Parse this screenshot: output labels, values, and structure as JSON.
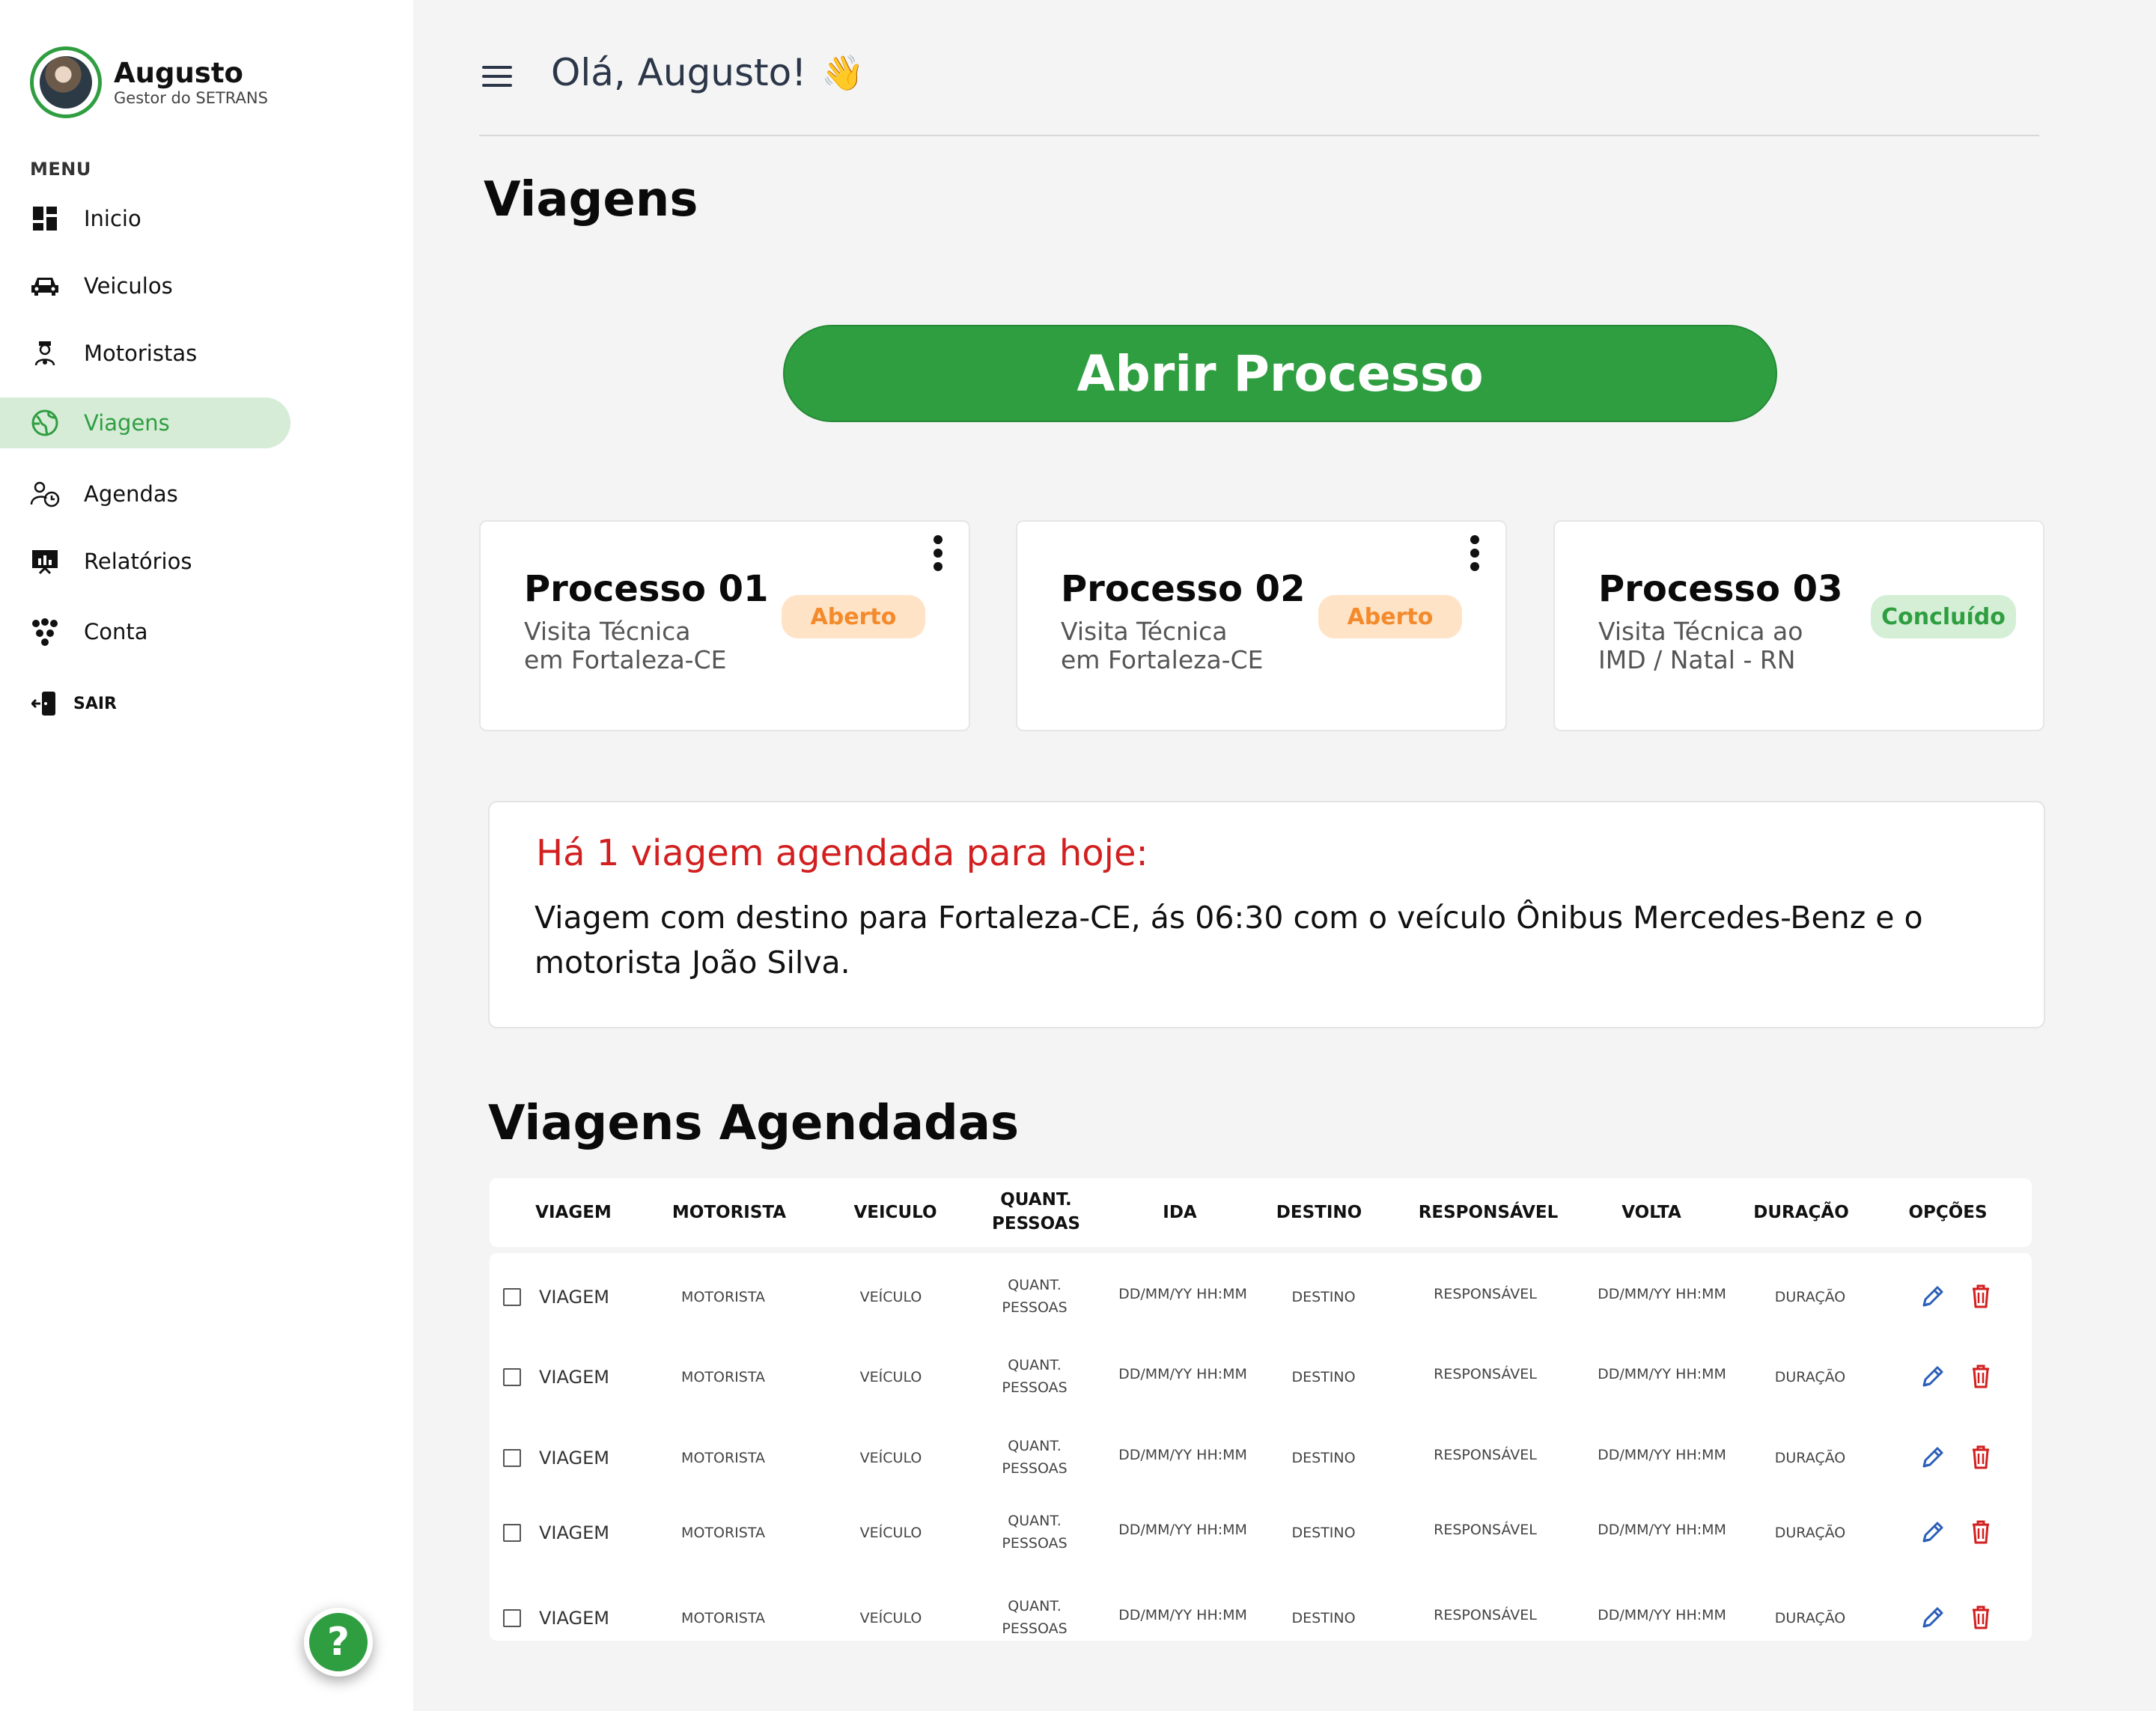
{
  "user": {
    "name": "Augusto",
    "role": "Gestor do SETRANS"
  },
  "menu": {
    "title": "MENU",
    "items": [
      {
        "label": "Inicio",
        "icon": "dashboard-icon"
      },
      {
        "label": "Veiculos",
        "icon": "car-icon"
      },
      {
        "label": "Motoristas",
        "icon": "driver-icon"
      },
      {
        "label": "Viagens",
        "icon": "globe-icon",
        "active": true
      },
      {
        "label": "Agendas",
        "icon": "schedule-icon"
      },
      {
        "label": "Relatórios",
        "icon": "report-icon"
      },
      {
        "label": "Conta",
        "icon": "account-icon"
      }
    ],
    "logout": "SAIR"
  },
  "help": {
    "label": "?"
  },
  "header": {
    "greeting": "Olá, Augusto!",
    "wave": "👋"
  },
  "page": {
    "title": "Viagens",
    "open_button": "Abrir Processo"
  },
  "colors": {
    "accent": "#2f9e41",
    "open_badge_bg": "#ffe3c7",
    "open_badge_text": "#f38a2b",
    "done_badge_bg": "#d4efd6",
    "alert_title": "#d21f1f"
  },
  "processes": [
    {
      "title": "Processo 01",
      "desc_line1": "Visita Técnica",
      "desc_line2": "em Fortaleza-CE",
      "status": "Aberto"
    },
    {
      "title": "Processo 02",
      "desc_line1": "Visita Técnica",
      "desc_line2": "em Fortaleza-CE",
      "status": "Aberto"
    },
    {
      "title": "Processo 03",
      "desc_line1": "Visita Técnica ao",
      "desc_line2": "IMD / Natal - RN",
      "status": "Concluído"
    }
  ],
  "alert": {
    "title": "Há 1 viagem agendada para hoje:",
    "body": "Viagem com destino para Fortaleza-CE, ás 06:30 com o veículo Ônibus Mercedes-Benz e o motorista João Silva."
  },
  "schedule": {
    "title": "Viagens Agendadas",
    "headers": [
      "VIAGEM",
      "MOTORISTA",
      "VEICULO",
      "QUANT.",
      "PESSOAS",
      "IDA",
      "DESTINO",
      "RESPONSÁVEL",
      "VOLTA",
      "DURAÇÃO",
      "OPÇÕES"
    ],
    "row": {
      "viagem": "VIAGEM",
      "motorista": "MOTORISTA",
      "veiculo": "VEÍCULO",
      "quant1": "QUANT.",
      "quant2": "PESSOAS",
      "ida": "DD/MM/YY HH:MM",
      "destino": "DESTINO",
      "responsavel": "RESPONSÁVEL",
      "volta": "DD/MM/YY HH:MM",
      "duracao": "DURAÇÃO"
    },
    "row_count": 5
  }
}
